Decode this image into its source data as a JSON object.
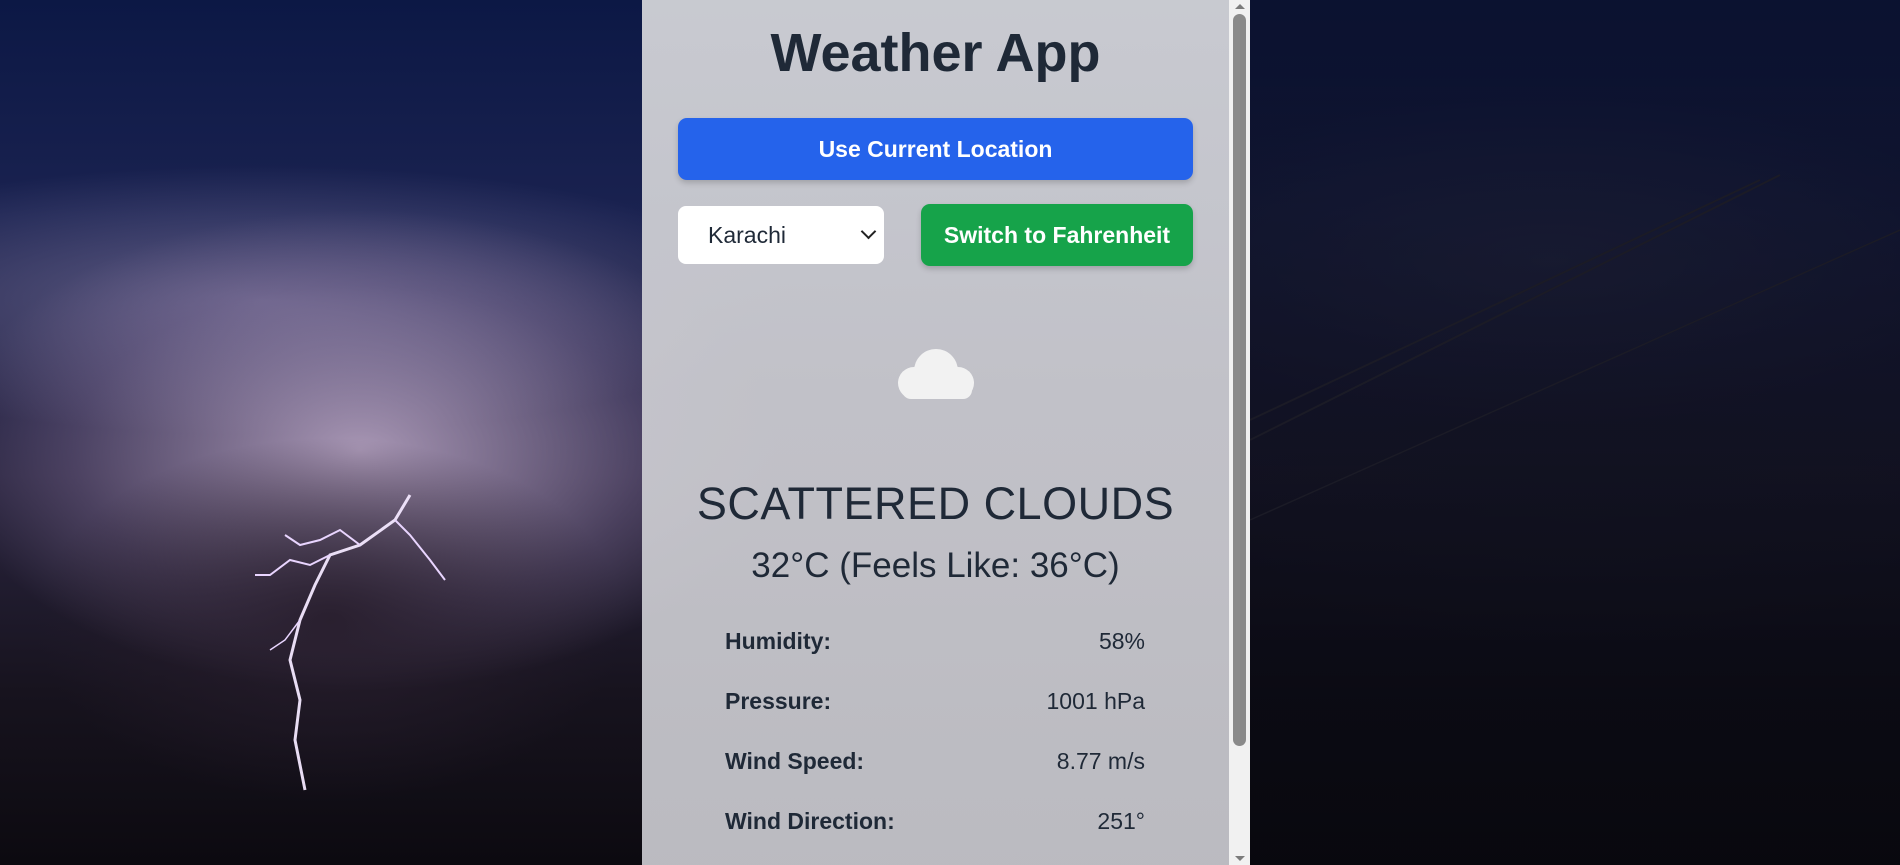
{
  "app": {
    "title": "Weather App"
  },
  "controls": {
    "location_button_label": "Use Current Location",
    "city_select": {
      "selected": "Karachi"
    },
    "unit_toggle_label": "Switch to Fahrenheit"
  },
  "weather": {
    "icon": "cloud-icon",
    "condition": "SCATTERED CLOUDS",
    "temperature_line": "32°C (Feels Like: 36°C)",
    "stats": [
      {
        "label": "Humidity:",
        "value": "58%"
      },
      {
        "label": "Pressure:",
        "value": "1001 hPa"
      },
      {
        "label": "Wind Speed:",
        "value": "8.77 m/s"
      },
      {
        "label": "Wind Direction:",
        "value": "251°"
      }
    ]
  },
  "colors": {
    "primary_button": "#2563eb",
    "secondary_button": "#16a34a",
    "text": "#1f2937"
  }
}
